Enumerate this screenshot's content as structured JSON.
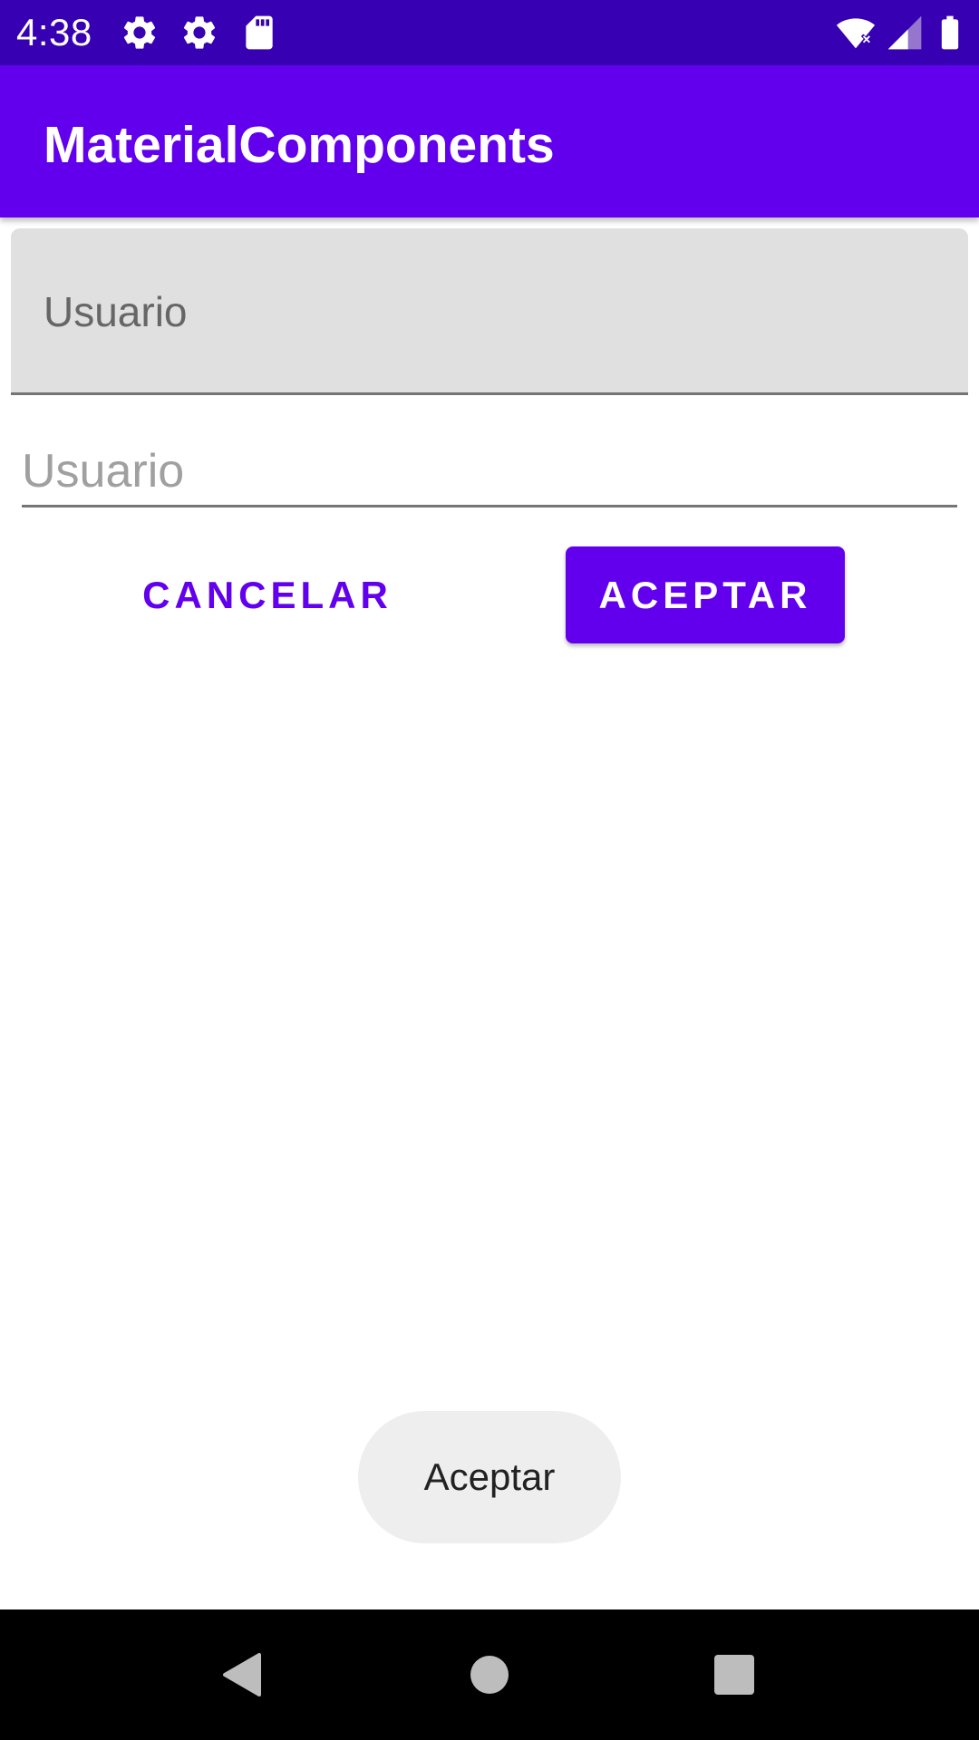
{
  "status_bar": {
    "time": "4:38",
    "icons": [
      "settings-icon",
      "settings-icon",
      "sd-card-icon",
      "wifi-icon",
      "signal-icon",
      "battery-icon"
    ],
    "color": "#3700b3"
  },
  "app_bar": {
    "title": "MaterialComponents",
    "color": "#6200ee"
  },
  "filled_field": {
    "label": "Usuario"
  },
  "plain_field": {
    "placeholder": "Usuario",
    "value": ""
  },
  "buttons": {
    "cancel_label": "CANCELAR",
    "accept_label": "ACEPTAR"
  },
  "toast": {
    "message": "Aceptar"
  },
  "nav_bar": {
    "icons": [
      "back-icon",
      "home-icon",
      "recents-icon"
    ]
  }
}
